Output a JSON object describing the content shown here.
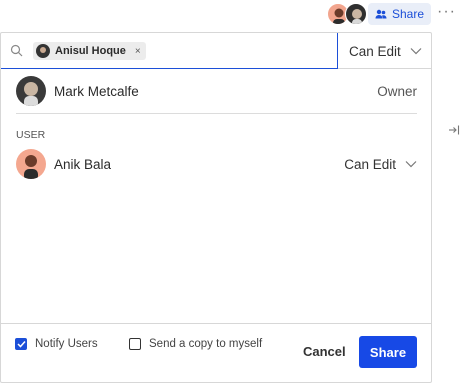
{
  "topbar": {
    "share_label": "Share",
    "share_color": "#1c4fd8",
    "more_label": "···"
  },
  "search": {
    "chip_name": "Anisul Hoque",
    "chip_close": "×",
    "permission": "Can Edit"
  },
  "owner": {
    "name": "Mark Metcalfe",
    "role": "Owner"
  },
  "users": {
    "section_label": "USER",
    "items": [
      {
        "name": "Anik Bala",
        "role": "Can Edit"
      }
    ]
  },
  "footer": {
    "notify_label": "Notify Users",
    "notify_checked": true,
    "copy_label": "Send a copy to myself",
    "copy_checked": false,
    "cancel_label": "Cancel",
    "share_label": "Share",
    "share_color": "#1749e6"
  }
}
